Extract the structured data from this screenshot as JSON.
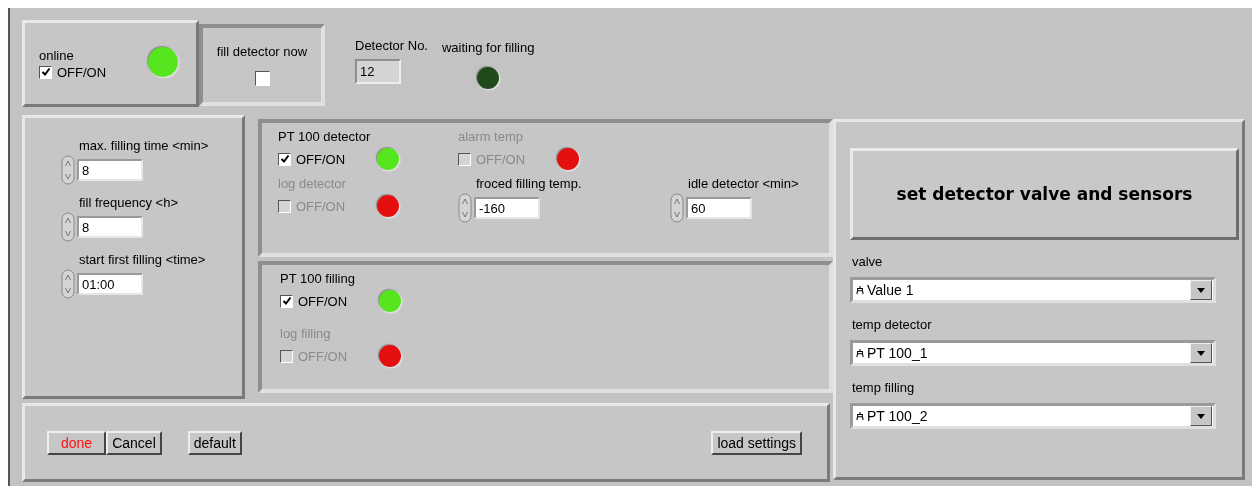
{
  "online": {
    "label": "online",
    "checkbox": {
      "label": "OFF/ON",
      "checked": true,
      "disabled": false
    },
    "led": {
      "color": "#55e61e"
    }
  },
  "fill_now": {
    "label": "fill detector now",
    "checked": false
  },
  "detector_no": {
    "label": "Detector No.",
    "value": "12"
  },
  "waiting": {
    "label": "waiting for filling",
    "led": {
      "color": "#1f4a1c"
    }
  },
  "timing": [
    {
      "label": "max. filling time <min>",
      "value": "8"
    },
    {
      "label": "fill frequency <h>",
      "value": "8"
    },
    {
      "label": "start first filling <time>",
      "value": "01:00"
    }
  ],
  "detector": {
    "pt100": {
      "label": "PT 100 detector",
      "checkbox": {
        "label": "OFF/ON",
        "checked": true,
        "disabled": false
      },
      "led": {
        "color": "#55e61e"
      }
    },
    "alarm": {
      "label": "alarm temp",
      "checkbox": {
        "label": "OFF/ON",
        "checked": false,
        "disabled": true
      },
      "led": {
        "color": "#e60f0f"
      }
    },
    "log": {
      "label": "log detector",
      "checkbox": {
        "label": "OFF/ON",
        "checked": false,
        "disabled": true
      },
      "led": {
        "color": "#e60f0f"
      }
    },
    "forced": {
      "label": "froced filling temp.",
      "value": "-160"
    },
    "idle": {
      "label": "idle detector <min>",
      "value": "60"
    }
  },
  "filling": {
    "pt100": {
      "label": "PT 100 filling",
      "checkbox": {
        "label": "OFF/ON",
        "checked": true,
        "disabled": false
      },
      "led": {
        "color": "#55e61e"
      }
    },
    "log": {
      "label": "log filling",
      "checkbox": {
        "label": "OFF/ON",
        "checked": false,
        "disabled": true
      },
      "led": {
        "color": "#e60f0f"
      }
    }
  },
  "set_button": "set detector valve and sensors",
  "selectors": [
    {
      "label": "valve",
      "value": "Value 1"
    },
    {
      "label": "temp detector",
      "value": "PT 100_1"
    },
    {
      "label": "temp filling",
      "value": "PT 100_2"
    }
  ],
  "buttons": [
    {
      "label": "done",
      "highlighted": true
    },
    {
      "label": "Cancel",
      "highlighted": false
    },
    {
      "label": "default",
      "highlighted": false
    },
    {
      "label": "load settings",
      "highlighted": false
    }
  ]
}
